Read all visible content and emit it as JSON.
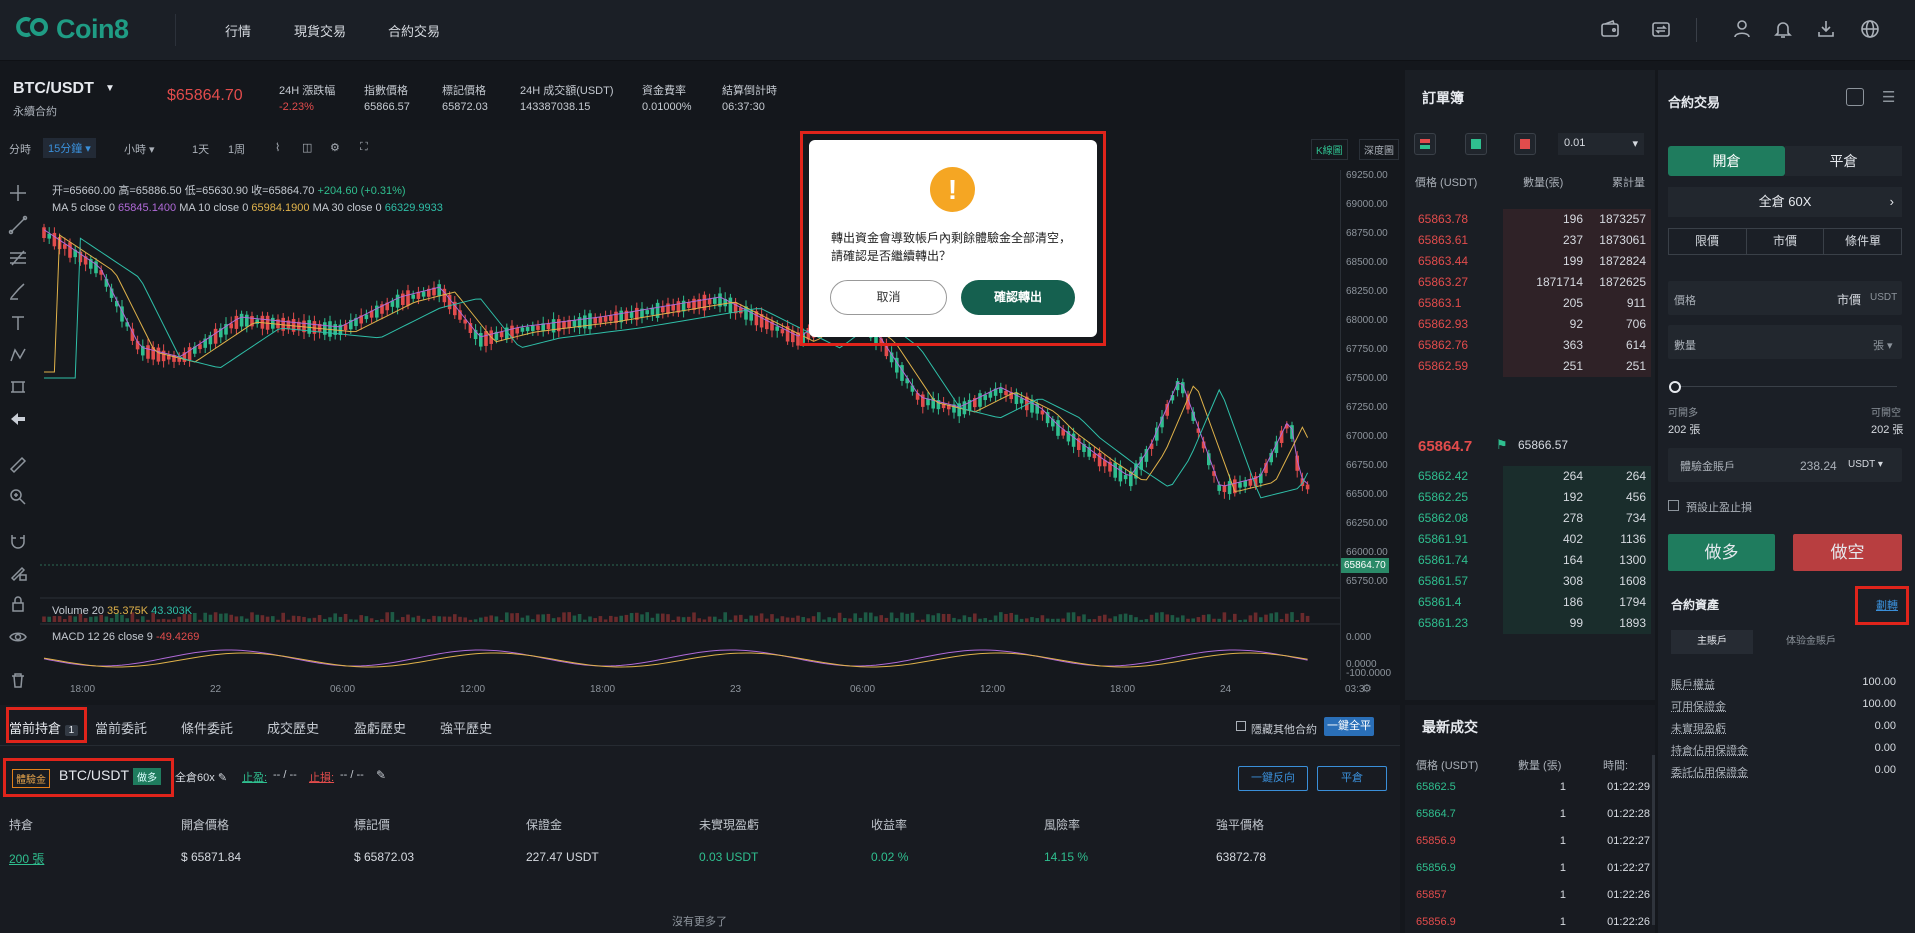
{
  "brand": {
    "name": "Coin8"
  },
  "nav": {
    "items": [
      "行情",
      "現貨交易",
      "合約交易"
    ]
  },
  "ticker": {
    "pair": "BTC/USDT",
    "contract_type": "永續合約",
    "last_price": "$65864.70",
    "change_label": "24H 漲跌幅",
    "change_value": "-2.23%",
    "index_label": "指數價格",
    "index_value": "65866.57",
    "mark_label": "標記價格",
    "mark_value": "65872.03",
    "volume_label": "24H 成交額(USDT)",
    "volume_value": "143387038.15",
    "funding_label": "資金費率",
    "funding_value": "0.01000%",
    "countdown_label": "結算倒計時",
    "countdown_value": "06:37:30"
  },
  "timeframes": [
    "分時",
    "15分鐘",
    "小時",
    "1天",
    "1周"
  ],
  "chart_view_tabs": [
    "K線圖",
    "深度圖"
  ],
  "chart": {
    "ohlc_open": "开=65660.00",
    "ohlc_high": "高=65886.50",
    "ohlc_low": "低=65630.90",
    "ohlc_close": "收=65864.70",
    "ohlc_change": "+204.60 (+0.31%)",
    "ma5_label": "MA 5 close 0",
    "ma5_value": "65845.1400",
    "ma10_label": "MA 10 close 0",
    "ma10_value": "65984.1900",
    "ma30_label": "MA 30 close 0",
    "ma30_value": "66329.9933",
    "volume_label": "Volume 20",
    "volume_v1": "35.375K",
    "volume_v2": "43.303K",
    "macd_label": "MACD 12 26 close 9",
    "macd_value": "-49.4269",
    "current_price_tag": "65864.70",
    "price_axis": [
      "69250.00",
      "69000.00",
      "68750.00",
      "68500.00",
      "68250.00",
      "68000.00",
      "67750.00",
      "67500.00",
      "67250.00",
      "67000.00",
      "66750.00",
      "66500.00",
      "66250.00",
      "66000.00",
      "65750.00"
    ],
    "sub_axis": [
      "0.000",
      "0.0000",
      "-100.0000"
    ],
    "time_axis": [
      "18:00",
      "22",
      "06:00",
      "12:00",
      "18:00",
      "23",
      "06:00",
      "12:00",
      "18:00",
      "24",
      "03:3"
    ]
  },
  "orderbook": {
    "title": "訂單簿",
    "precision": "0.01",
    "col_price": "價格 (USDT)",
    "col_qty": "數量(張)",
    "col_total": "累計量",
    "asks": [
      {
        "price": "65863.78",
        "qty": "196",
        "total": "1873257",
        "depth": 0.35
      },
      {
        "price": "65863.61",
        "qty": "237",
        "total": "1873061",
        "depth": 0.35
      },
      {
        "price": "65863.44",
        "qty": "199",
        "total": "1872824",
        "depth": 0.35
      },
      {
        "price": "65863.27",
        "qty": "1871714",
        "total": "1872625",
        "depth": 0.35
      },
      {
        "price": "65863.1",
        "qty": "205",
        "total": "911",
        "depth": 0.35
      },
      {
        "price": "65862.93",
        "qty": "92",
        "total": "706",
        "depth": 0.35
      },
      {
        "price": "65862.76",
        "qty": "363",
        "total": "614",
        "depth": 0.35
      },
      {
        "price": "65862.59",
        "qty": "251",
        "total": "251",
        "depth": 0.35
      }
    ],
    "mid_price": "65864.7",
    "mid_index": "65866.57",
    "bids": [
      {
        "price": "65862.42",
        "qty": "264",
        "total": "264",
        "depth": 0.35
      },
      {
        "price": "65862.25",
        "qty": "192",
        "total": "456",
        "depth": 0.35
      },
      {
        "price": "65862.08",
        "qty": "278",
        "total": "734",
        "depth": 0.35
      },
      {
        "price": "65861.91",
        "qty": "402",
        "total": "1136",
        "depth": 0.35
      },
      {
        "price": "65861.74",
        "qty": "164",
        "total": "1300",
        "depth": 0.35
      },
      {
        "price": "65861.57",
        "qty": "308",
        "total": "1608",
        "depth": 0.35
      },
      {
        "price": "65861.4",
        "qty": "186",
        "total": "1794",
        "depth": 0.35
      },
      {
        "price": "65861.23",
        "qty": "99",
        "total": "1893",
        "depth": 0.35
      }
    ]
  },
  "bottom_tabs": {
    "positions": "當前持倉",
    "positions_count": "1",
    "open_orders": "當前委託",
    "conditional": "條件委託",
    "trade_history": "成交歷史",
    "pnl_history": "盈虧歷史",
    "liquidation_history": "強平歷史",
    "hide_other": "隱藏其他合約",
    "close_all": "一鍵全平"
  },
  "position": {
    "account_badge": "體驗金",
    "symbol": "BTC/USDT",
    "side": "做多",
    "margin_mode": "全倉60x",
    "tp_label": "止盈:",
    "tp_value": "-- / --",
    "sl_label": "止損:",
    "sl_value": "-- / --",
    "reverse_btn": "一鍵反向",
    "close_btn": "平倉",
    "headers": [
      "持倉",
      "開倉價格",
      "標記價",
      "保證金",
      "未實現盈虧",
      "收益率",
      "風險率",
      "強平價格"
    ],
    "values": [
      "200 張",
      "$ 65871.84",
      "$ 65872.03",
      "227.47 USDT",
      "0.03 USDT",
      "0.02 %",
      "14.15 %",
      "63872.78"
    ],
    "no_more": "沒有更多了"
  },
  "trades": {
    "title": "最新成交",
    "col_price": "價格 (USDT)",
    "col_qty": "數量 (張)",
    "col_time": "時間:",
    "rows": [
      {
        "price": "65862.5",
        "qty": "1",
        "time": "01:22:29",
        "side": "buy"
      },
      {
        "price": "65864.7",
        "qty": "1",
        "time": "01:22:28",
        "side": "buy"
      },
      {
        "price": "65856.9",
        "qty": "1",
        "time": "01:22:27",
        "side": "sell"
      },
      {
        "price": "65856.9",
        "qty": "1",
        "time": "01:22:27",
        "side": "buy"
      },
      {
        "price": "65857",
        "qty": "1",
        "time": "01:22:26",
        "side": "sell"
      },
      {
        "price": "65856.9",
        "qty": "1",
        "time": "01:22:26",
        "side": "sell"
      }
    ]
  },
  "trade_panel": {
    "title": "合約交易",
    "open_tab": "開倉",
    "close_tab": "平倉",
    "leverage": "全倉 60X",
    "order_types": [
      "限價",
      "市價",
      "條件單"
    ],
    "price_label": "價格",
    "price_mode": "市價",
    "price_unit": "USDT",
    "qty_label": "數量",
    "qty_unit": "張",
    "can_long_label": "可開多",
    "can_long_value": "202 張",
    "can_short_label": "可開空",
    "can_short_value": "202 張",
    "account_label": "體驗金賬戶",
    "account_value": "238.24",
    "account_unit": "USDT",
    "tpsl_label": "預設止盈止損",
    "long_btn": "做多",
    "short_btn": "做空",
    "assets_title": "合約資產",
    "transfer": "劃轉",
    "main_account": "主賬戶",
    "trial_account": "体验金賬戶",
    "asset_rows": [
      {
        "label": "賬戶權益",
        "value": "100.00"
      },
      {
        "label": "可用保證金",
        "value": "100.00"
      },
      {
        "label": "未實現盈虧",
        "value": "0.00"
      },
      {
        "label": "持倉佔用保證金",
        "value": "0.00"
      },
      {
        "label": "委託佔用保證金",
        "value": "0.00"
      }
    ]
  },
  "dialog": {
    "message": "轉出資金會導致帳戶內剩餘體驗金全部清空，請確認是否繼續轉出？",
    "cancel": "取消",
    "confirm": "確認轉出"
  },
  "colors": {
    "up": "#2fbf8f",
    "down": "#e24c4c",
    "accent": "#1f9c84",
    "highlight": "#e0241b"
  }
}
